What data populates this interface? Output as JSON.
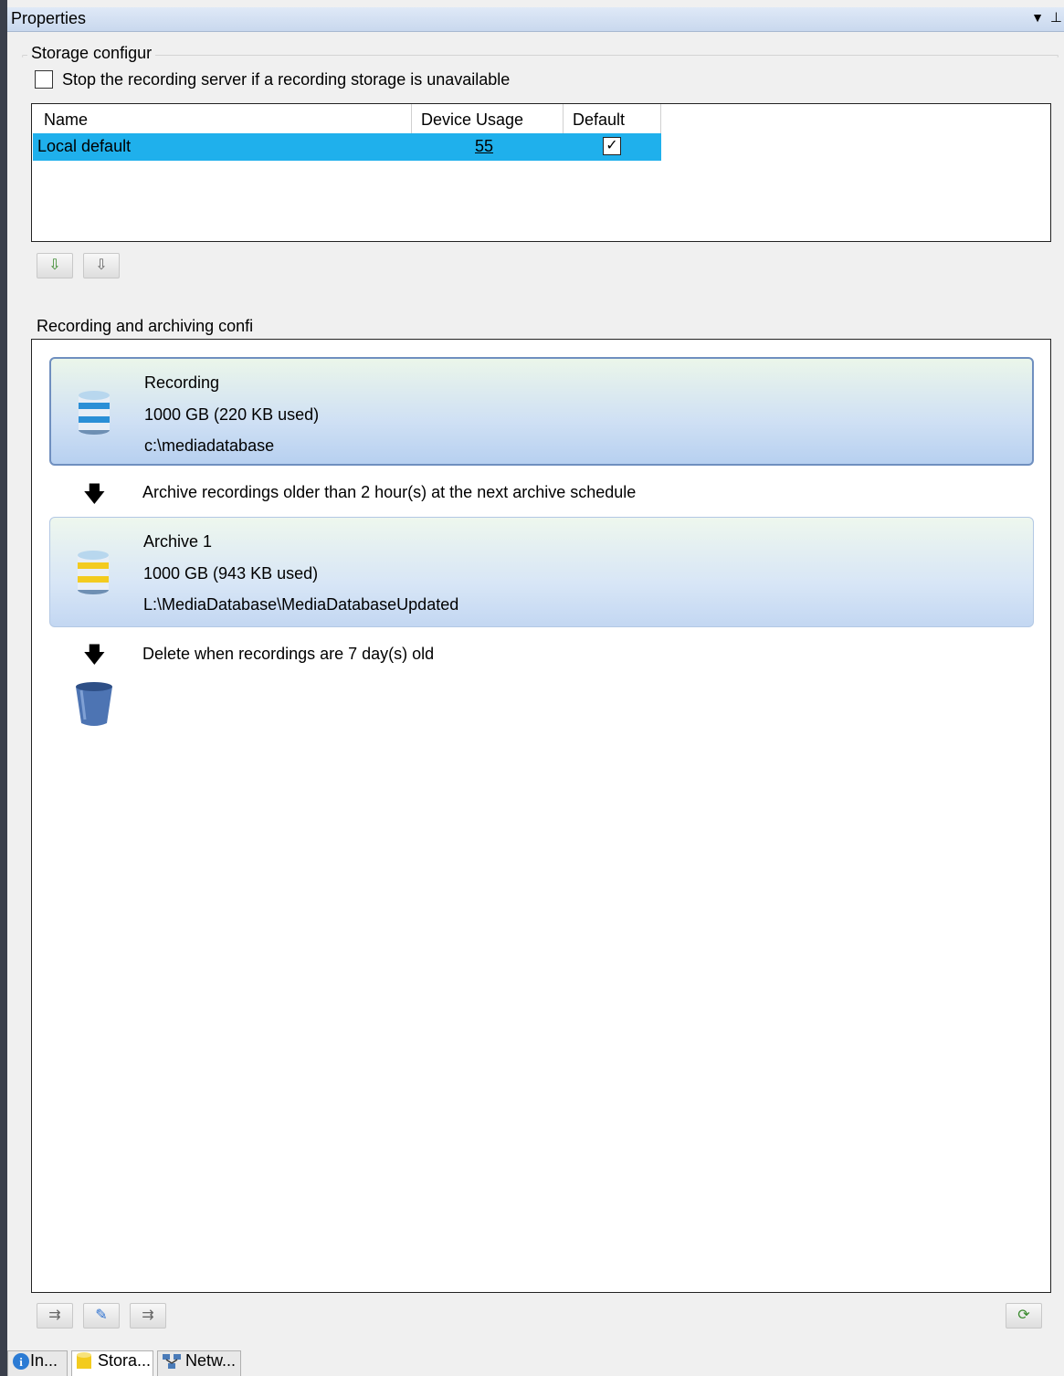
{
  "window": {
    "title": "Properties",
    "dropdown_icon": "dropdown-arrow-icon",
    "pin_icon": "pin-icon"
  },
  "storage_configuration": {
    "group_label": "Storage configur",
    "stop_checkbox_label": "Stop the recording server if a recording storage is unavailable",
    "stop_checkbox_checked": false,
    "table": {
      "columns": [
        "Name",
        "Device Usage",
        "Default"
      ],
      "rows": [
        {
          "name": "Local default",
          "device_usage": "55",
          "default": true,
          "selected": true
        }
      ]
    },
    "toolbar": {
      "add_icon": "add-storage-icon",
      "remove_icon": "remove-storage-icon"
    }
  },
  "recording_archiving": {
    "group_label": "Recording and archiving confi",
    "recording": {
      "title": "Recording",
      "size": "1000 GB (220 KB used)",
      "path": "c:\\mediadatabase"
    },
    "archive_rule": "Archive recordings older than 2 hour(s) at the next archive schedule",
    "archive": {
      "title": "Archive 1",
      "size": "1000 GB (943 KB used)",
      "path": "L:\\MediaDatabase\\MediaDatabaseUpdated"
    },
    "delete_rule": "Delete when recordings are 7 day(s) old",
    "toolbar": {
      "add_archive_icon": "add-archive-icon",
      "edit_archive_icon": "edit-archive-icon",
      "remove_archive_icon": "remove-archive-icon",
      "refresh_icon": "refresh-icon"
    }
  },
  "bottom_tabs": [
    {
      "label": "In...",
      "icon": "info-icon"
    },
    {
      "label": "Stora...",
      "icon": "storage-icon",
      "active": true
    },
    {
      "label": "Netw...",
      "icon": "network-icon"
    }
  ],
  "colors": {
    "selection": "#1fb0ec",
    "card_border": "#6f8fbf"
  }
}
